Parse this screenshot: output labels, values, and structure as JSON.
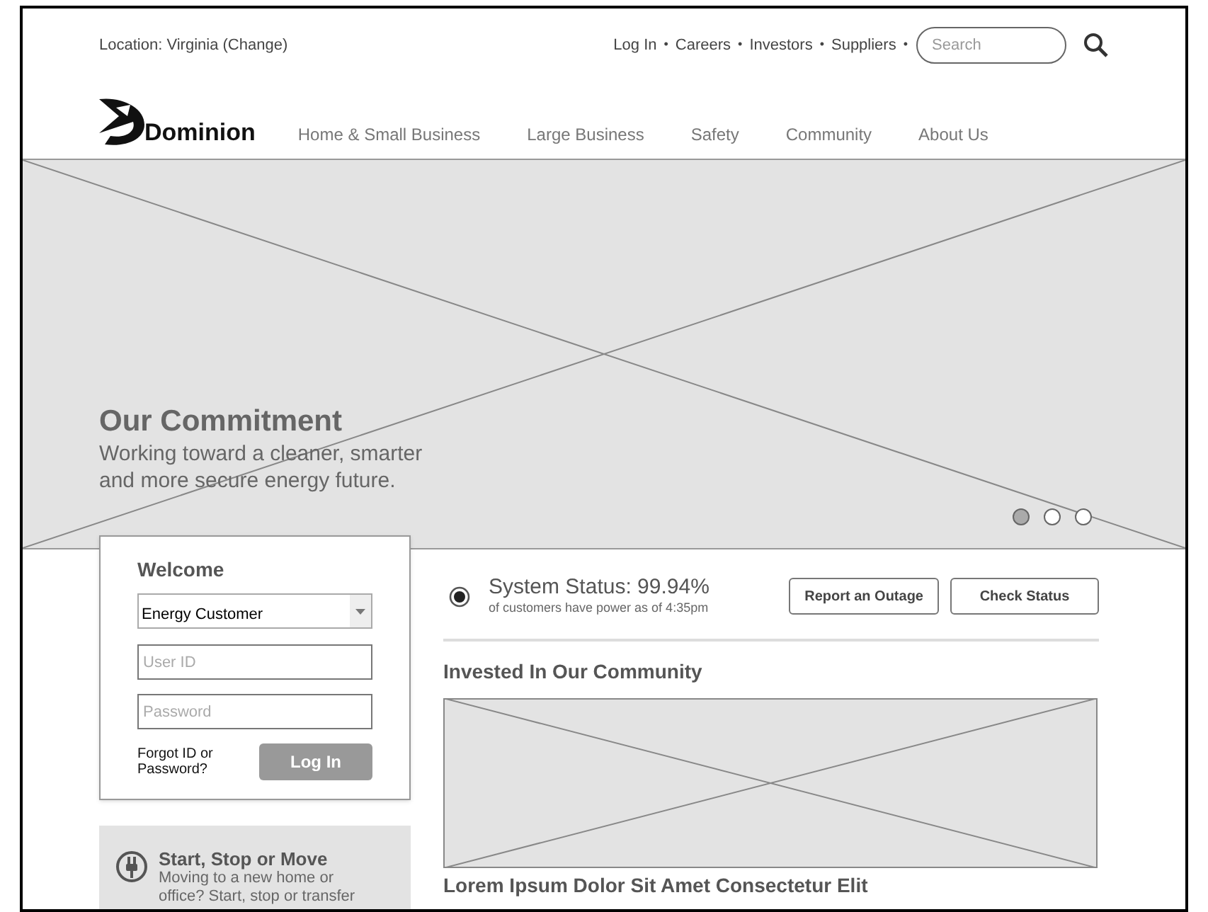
{
  "top_bar": {
    "location": "Location: Virginia (Change)",
    "links": [
      "Log In",
      "Careers",
      "Investors",
      "Suppliers"
    ],
    "separator": "•",
    "search": {
      "placeholder": "Search"
    }
  },
  "header": {
    "logo_text": "Dominion",
    "nav": [
      "Home & Small Business",
      "Large Business",
      "Safety",
      "Community",
      "About Us"
    ]
  },
  "hero": {
    "title": "Our Commitment",
    "text": "Working toward a cleaner, smarter and more secure energy future.",
    "dots": [
      {
        "selected": true
      },
      {
        "selected": false
      },
      {
        "selected": false
      }
    ]
  },
  "login": {
    "title": "Welcome",
    "account_type": "Energy Customer",
    "user_id": {
      "placeholder": "User ID"
    },
    "password": {
      "placeholder": "Password"
    },
    "forgot": "Forgot ID or Password?",
    "button": "Log In"
  },
  "start_stop": {
    "title": "Start, Stop or Move",
    "text": "Moving to a new home or office? Start, stop or transfer"
  },
  "status": {
    "title": "System Status: 99.94%",
    "subtitle": "of customers have power as of 4:35pm",
    "buttons": [
      "Report an Outage",
      "Check Status"
    ]
  },
  "community": {
    "heading": "Invested In Our Community",
    "article_title": "Lorem Ipsum Dolor Sit Amet Consectetur Elit"
  }
}
